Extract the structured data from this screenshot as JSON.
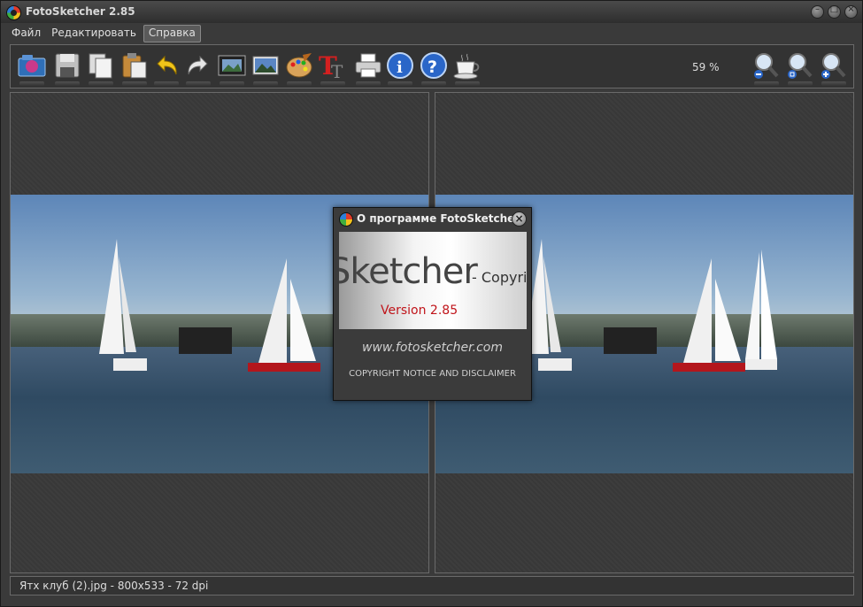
{
  "window": {
    "title": "FotoSketcher 2.85"
  },
  "menu": [
    {
      "label": "Файл"
    },
    {
      "label": "Редактировать"
    },
    {
      "label": "Справка"
    }
  ],
  "toolbar": {
    "icons": [
      "open-image-icon",
      "save-icon",
      "copy-icon",
      "paste-icon",
      "undo-icon",
      "redo-icon",
      "filmstrip-icon",
      "landscape-icon",
      "palette-icon",
      "text-icon",
      "print-icon",
      "info-icon",
      "help-icon",
      "coffee-icon"
    ],
    "zoom_level": "59 %",
    "zoom_icons": [
      "zoom-out-icon",
      "zoom-fit-icon",
      "zoom-in-icon"
    ]
  },
  "status": {
    "text": "Ятх клуб (2).jpg - 800x533 - 72 dpi"
  },
  "dialog": {
    "title": "О программе FotoSketcher",
    "logo_text": "Sketcher",
    "copyright_text": "- Copyrig",
    "version": "Version 2.85",
    "url": "www.fotosketcher.com",
    "notice": "COPYRIGHT NOTICE AND DISCLAIMER"
  }
}
